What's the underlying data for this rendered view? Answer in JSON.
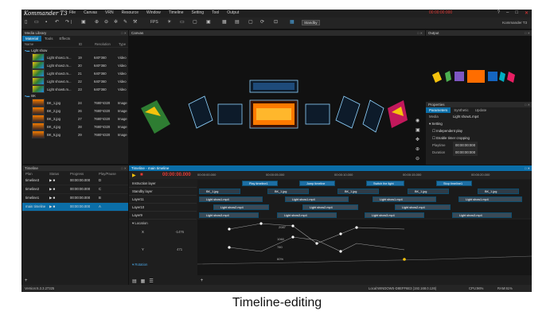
{
  "app": {
    "logo": "Kommander T3",
    "user": "Kommander T3",
    "timecode": "00:00:00:000"
  },
  "menu": [
    "File",
    "Canvas",
    "VRN",
    "Resource",
    "Window",
    "Timeline",
    "Setting",
    "Tool",
    "Output"
  ],
  "toolbar": {
    "fps": "FPS",
    "standby": "Standby"
  },
  "media_library": {
    "title": "Media Library",
    "tabs": [
      "Material",
      "Tools",
      "Effects"
    ],
    "columns": [
      "Name",
      "ID",
      "Resolution",
      "Type"
    ],
    "groups": [
      {
        "name": "Light show",
        "items": [
          {
            "name": "Light show1.m...",
            "id": "19",
            "res": "640*360",
            "type": "Video"
          },
          {
            "name": "Light show2.m...",
            "id": "20",
            "res": "640*360",
            "type": "Video"
          },
          {
            "name": "Light show3.m...",
            "id": "21",
            "res": "640*360",
            "type": "Video"
          },
          {
            "name": "Light show4.m...",
            "id": "22",
            "res": "640*360",
            "type": "Video"
          },
          {
            "name": "Light show5.m...",
            "id": "23",
            "res": "640*360",
            "type": "Video"
          }
        ]
      },
      {
        "name": "BK",
        "items": [
          {
            "name": "BK_1.jpg",
            "id": "24",
            "res": "7680*4320",
            "type": "Image"
          },
          {
            "name": "BK_2.jpg",
            "id": "26",
            "res": "7680*4320",
            "type": "Image"
          },
          {
            "name": "BK_3.jpg",
            "id": "27",
            "res": "7680*4320",
            "type": "Image"
          },
          {
            "name": "BK_4.jpg",
            "id": "28",
            "res": "7680*4320",
            "type": "Image"
          },
          {
            "name": "BK_5.jpg",
            "id": "29",
            "res": "7680*4320",
            "type": "Image"
          }
        ]
      }
    ]
  },
  "canvas": {
    "title": "Canvas"
  },
  "output": {
    "title": "Output"
  },
  "properties": {
    "title": "Properties",
    "tabs": [
      "Parameters",
      "Synthetic",
      "Update"
    ],
    "media_label": "Media",
    "media_value": "Light show1.mp4",
    "section": "Setting",
    "independent_play": "Independent play",
    "enable_timer_cropping": "Enable timer cropping",
    "playtime_label": "Playtime",
    "playtime_value": "00:00:00:000",
    "duration_label": "Duration",
    "duration_value": "00:00:00:000"
  },
  "timeline_list": {
    "title": "Timeline",
    "columns": [
      "Plan",
      "Status",
      "Progress",
      "Play/Pause"
    ],
    "rows": [
      {
        "plan": "timeline3",
        "progress": "00:00:00.000",
        "key": "D"
      },
      {
        "plan": "timeline2",
        "progress": "00:00:00.000",
        "key": "C"
      },
      {
        "plan": "timeline1",
        "progress": "00:00:00.000",
        "key": "B"
      },
      {
        "plan": "main timeline",
        "progress": "00:00:00.000",
        "key": "A"
      }
    ]
  },
  "main_timeline": {
    "title": "Timeline - main timeline",
    "timecode": "00:00:00.000",
    "ruler": [
      "00:00:00.000",
      "00:00:05.000",
      "00:00:10.000",
      "00:00:15.000",
      "00:00:20.000"
    ],
    "layers": [
      "Instruction layer",
      "Standby layer",
      "Layer11",
      "Layer10",
      "Layer9"
    ],
    "cues": [
      "Play timeline1",
      "Jump timeline",
      "Switch the light",
      "Stop timeline1"
    ],
    "clip_names": [
      "BK_1.jpg",
      "Light show1.mp4",
      "Light show2.mp4",
      "Light show3.mp4"
    ],
    "props": [
      "Location",
      "X",
      "Y",
      "Rotation"
    ],
    "values": [
      "-1476",
      "2087",
      "471",
      "1060",
      "780",
      "60%"
    ]
  },
  "status": {
    "version": "Version:6.3.3.27325",
    "local": "Local:WINDOWS-D8EFF6E3 (192.168.0.126)",
    "cpu": "CPU:96%",
    "ram": "RAM:61%"
  }
}
